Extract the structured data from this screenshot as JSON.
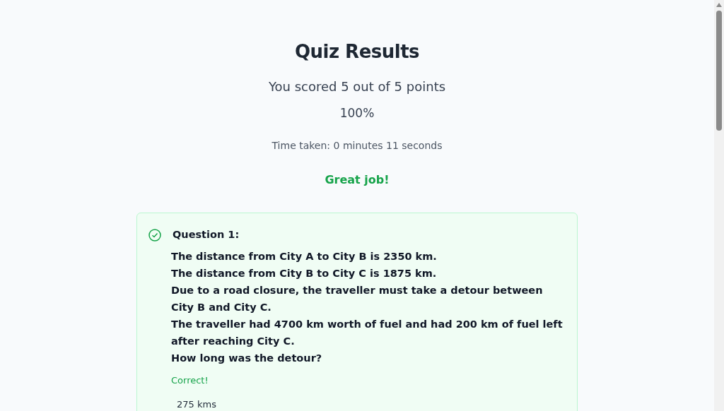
{
  "title": "Quiz Results",
  "score": "You scored 5 out of 5 points",
  "percentage": "100%",
  "time_taken": "Time taken: 0 minutes 11 seconds",
  "feedback": "Great job!",
  "questions": [
    {
      "label": "Question 1:",
      "correct": true,
      "lines": [
        "The distance from City A to City B is 2350 km.",
        "The distance from City B to City C is 1875 km.",
        "Due to a road closure, the traveller must take a detour between City B and City C.",
        "The traveller had 4700 km worth of fuel and had 200 km of fuel left after reaching City C.",
        "How long was the detour?"
      ],
      "result": "Correct!",
      "answer": "275 kms"
    }
  ]
}
